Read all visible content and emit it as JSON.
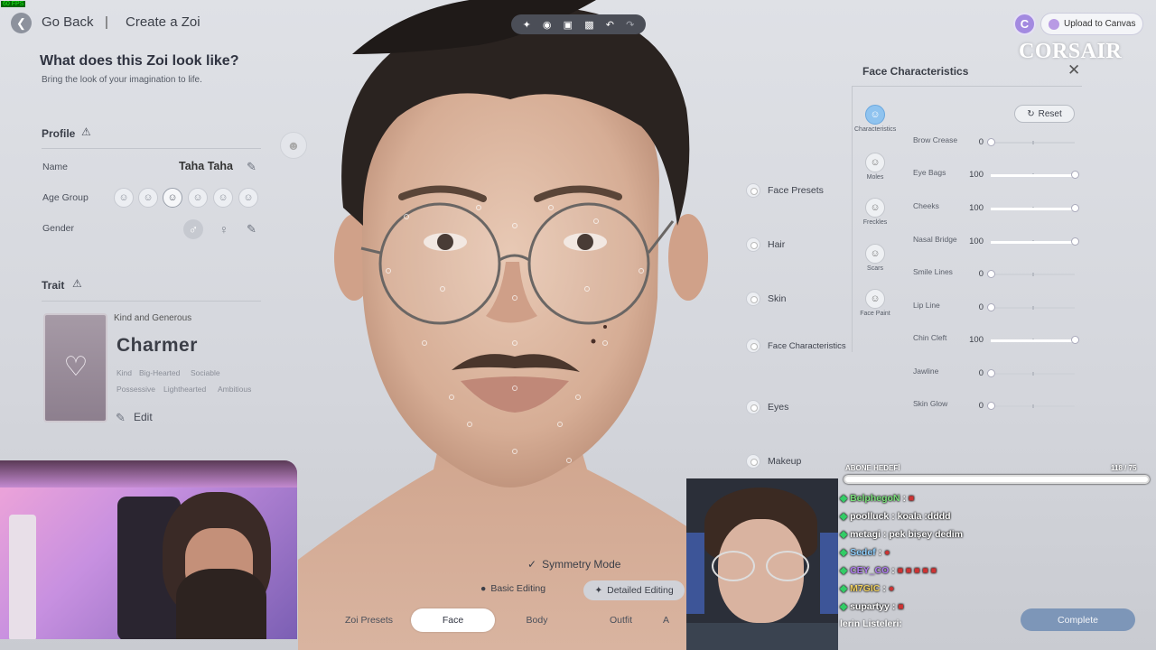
{
  "fps": "60 FPS",
  "nav": {
    "back": "Go Back",
    "separator": "|",
    "crumb": "Create a Zoi"
  },
  "header": {
    "title": "What does this Zoi look like?",
    "subtitle": "Bring the look of your imagination to life."
  },
  "profile": {
    "title": "Profile",
    "name_label": "Name",
    "name_value": "Taha Taha",
    "age_label": "Age Group",
    "gender_label": "Gender"
  },
  "trait": {
    "title": "Trait",
    "subtitle": "Kind and Generous",
    "name": "Charmer",
    "tags_row1": [
      "Kind",
      "Big-Hearted",
      "Sociable"
    ],
    "tags_row2": [
      "Possessive",
      "Lighthearted",
      "Ambitious"
    ],
    "edit": "Edit"
  },
  "toolbar_icons": [
    "sparkle-icon",
    "camera-icon",
    "frame-icon",
    "focus-icon",
    "undo-icon",
    "redo-icon"
  ],
  "top_right": {
    "canvas_letter": "C",
    "upload": "Upload to Canvas",
    "brand": "CORSAIR"
  },
  "side_menu": [
    "Face Presets",
    "Hair",
    "Skin",
    "Face Characteristics",
    "Eyes",
    "Makeup"
  ],
  "face_panel": {
    "title": "Face Characteristics",
    "reset": "Reset",
    "categories": [
      {
        "label": "Characteristics",
        "selected": true
      },
      {
        "label": "Moles",
        "selected": false
      },
      {
        "label": "Freckles",
        "selected": false
      },
      {
        "label": "Scars",
        "selected": false
      },
      {
        "label": "Face Paint",
        "selected": false
      }
    ],
    "sliders": [
      {
        "label": "Brow Crease",
        "value": 0
      },
      {
        "label": "Eye Bags",
        "value": 100
      },
      {
        "label": "Cheeks",
        "value": 100
      },
      {
        "label": "Nasal Bridge",
        "value": 100
      },
      {
        "label": "Smile Lines",
        "value": 0
      },
      {
        "label": "Lip Line",
        "value": 0
      },
      {
        "label": "Chin Cleft",
        "value": 100
      },
      {
        "label": "Jawline",
        "value": 0
      },
      {
        "label": "Skin Glow",
        "value": 0
      }
    ]
  },
  "bottom": {
    "symmetry": "Symmetry Mode",
    "basic": "Basic Editing",
    "detailed": "Detailed Editing",
    "tabs": [
      "Zoi Presets",
      "Face",
      "Body",
      "Outfit",
      "A"
    ],
    "selected_tab": 1,
    "complete": "Complete"
  },
  "stream": {
    "goal_label": "ABONE HEDEFİ",
    "goal_value": "118  / 75",
    "chat": [
      {
        "user": "BelphegoN",
        "msg": ":",
        "emote": "■"
      },
      {
        "user": "poolluck",
        "msg": ": koala :dddd",
        "emote": ""
      },
      {
        "user": "metagi",
        "msg": ": pek bişey dedim",
        "emote": ""
      },
      {
        "user": "Sedef",
        "msg": ":",
        "emote": "●"
      },
      {
        "user": "CEY_CO",
        "msg": ":",
        "emote": "■ ■ ■ ■ ■"
      },
      {
        "user": "M7GIC",
        "msg": ":",
        "emote": "●"
      },
      {
        "user": "supartyy",
        "msg": ":",
        "emote": "■"
      }
    ],
    "footer": "lerin Listeleri:",
    "user_colors": [
      "#7be07b",
      "#ffffff",
      "#ffffff",
      "#8fd0ff",
      "#b07cf0",
      "#f0d060",
      "#ffffff"
    ]
  }
}
